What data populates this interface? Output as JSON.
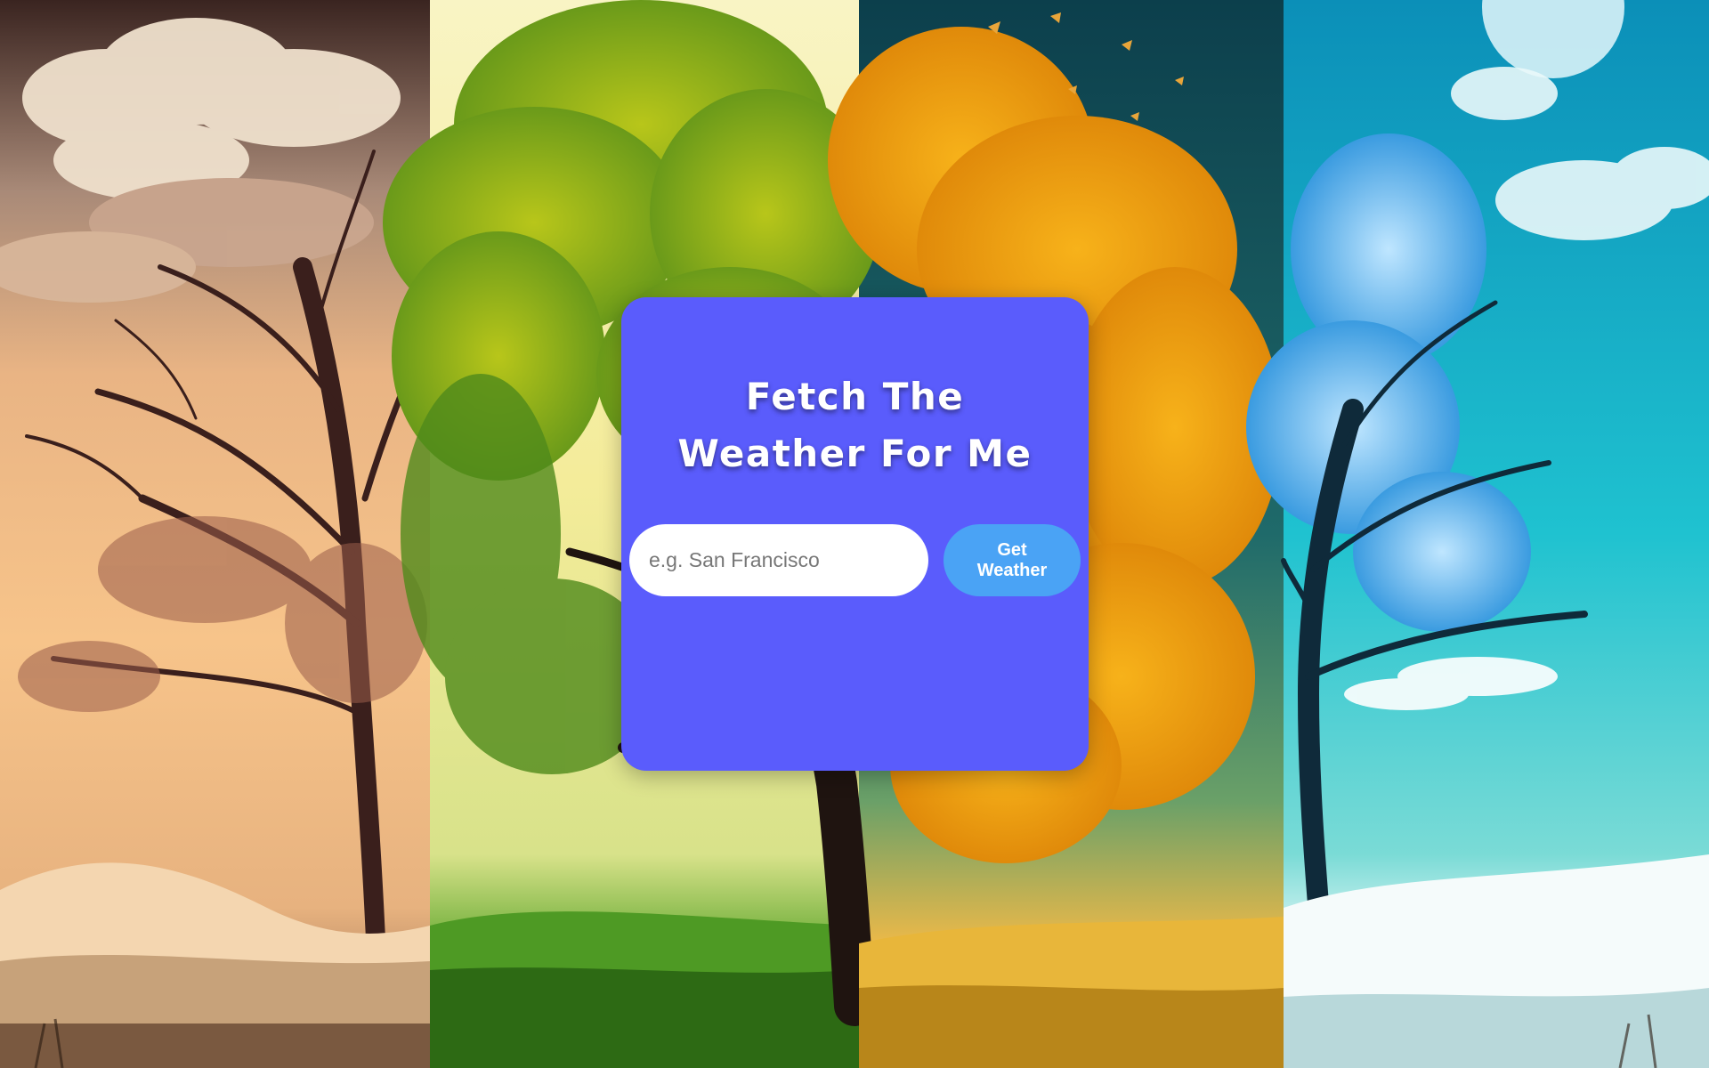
{
  "background": {
    "description_icon": "four-seasons-tree-icon",
    "panels": [
      {
        "season": "autumn-sepia",
        "sky_top": "#3a2420",
        "sky_mid": "#f2b87a",
        "ground": "#b88a5a"
      },
      {
        "season": "spring",
        "sky_top": "#f7f2b0",
        "sky_mid": "#f5f0a0",
        "ground": "#4a8a1f"
      },
      {
        "season": "autumn",
        "sky_top": "#0d4a55",
        "sky_mid": "#2f8a78",
        "ground": "#e8b23a"
      },
      {
        "season": "winter",
        "sky_top": "#0aa6c8",
        "sky_mid": "#22c7d2",
        "ground": "#e8f6f6"
      }
    ]
  },
  "card": {
    "color": "#5a5cfc",
    "title_line1": "Fetch The",
    "title_line2": "Weather For Me"
  },
  "search": {
    "placeholder": "e.g. San Francisco",
    "value": ""
  },
  "button": {
    "label_line1": "Get",
    "label_line2": "Weather",
    "color": "#4aa3f5"
  }
}
